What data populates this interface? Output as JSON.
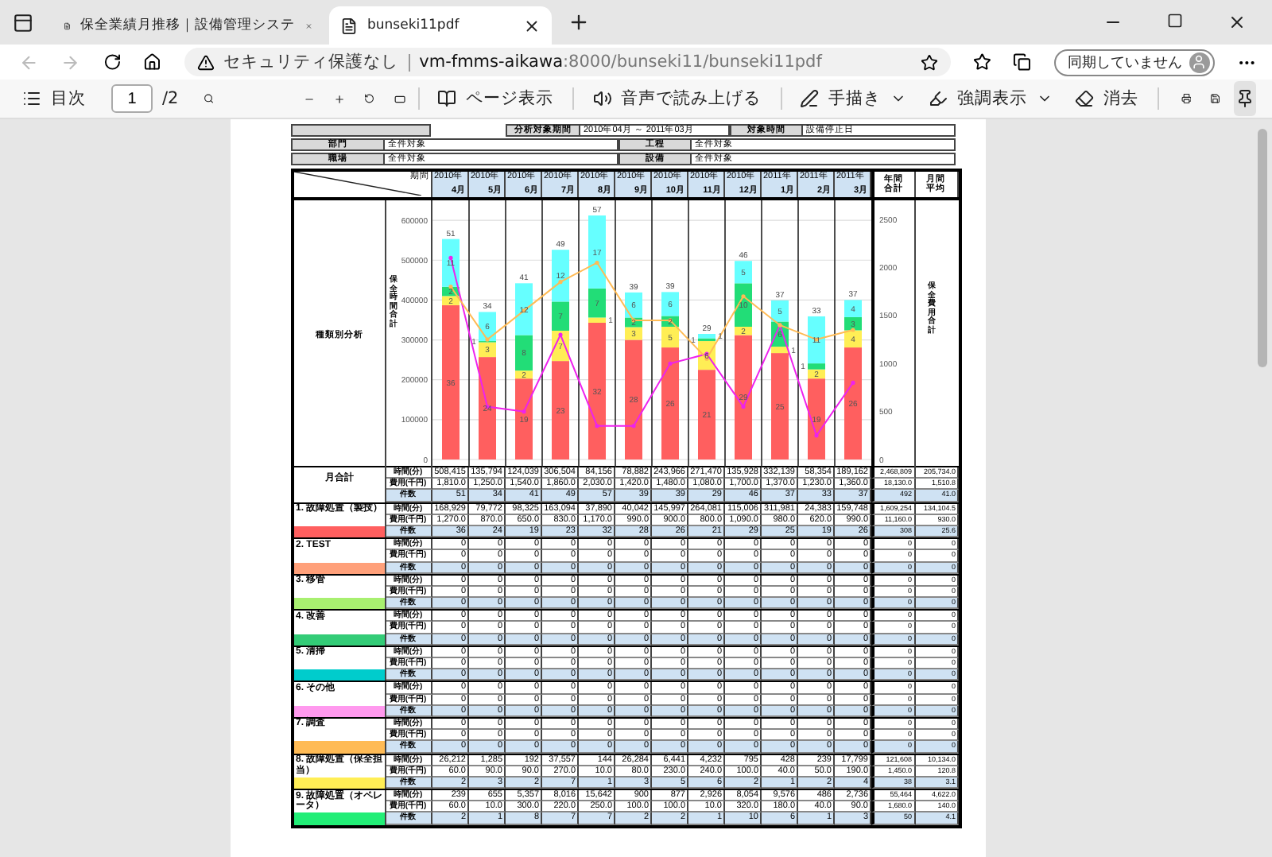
{
  "browser": {
    "tabs": [
      {
        "title": "保全業績月推移｜設備管理システ",
        "selected": false
      },
      {
        "title": "bunseki11pdf",
        "selected": true
      }
    ],
    "security_label": "セキュリティ保護なし",
    "url_host": "vm-fmms-aikawa",
    "url_path": ":8000/bunseki11/bunseki11pdf",
    "profile_label": "同期していません"
  },
  "pdf_toolbar": {
    "contents": "目次",
    "page": "1",
    "page_count": "/2",
    "page_view": "ページ表示",
    "read_aloud": "音声で読み上げる",
    "draw": "手描き",
    "highlight": "強調表示",
    "erase": "消去"
  },
  "report": {
    "period_label": "分析対象期間",
    "period_value": "2010年04月 ～ 2011年03月",
    "time_label": "対象時間",
    "time_value": "設備停止日",
    "filters": [
      [
        {
          "label": "部門",
          "value": "全件対象"
        },
        {
          "label": "工程",
          "value": "全件対象"
        }
      ],
      [
        {
          "label": "職場",
          "value": "全件対象"
        },
        {
          "label": "設備",
          "value": "全件対象"
        }
      ]
    ],
    "corner_label": "期間",
    "months": [
      {
        "year": "2010年",
        "month": "4月"
      },
      {
        "year": "2010年",
        "month": "5月"
      },
      {
        "year": "2010年",
        "month": "6月"
      },
      {
        "year": "2010年",
        "month": "7月"
      },
      {
        "year": "2010年",
        "month": "8月"
      },
      {
        "year": "2010年",
        "month": "9月"
      },
      {
        "year": "2010年",
        "month": "10月"
      },
      {
        "year": "2010年",
        "month": "11月"
      },
      {
        "year": "2010年",
        "month": "12月"
      },
      {
        "year": "2011年",
        "month": "1月"
      },
      {
        "year": "2011年",
        "month": "2月"
      },
      {
        "year": "2011年",
        "month": "3月"
      }
    ],
    "count_labels": {
      "totals": [
        "51",
        "34",
        "41",
        "49",
        "57",
        "39",
        "39",
        "29",
        "46",
        "37",
        "33",
        "37"
      ],
      "segments": [
        [
          "11",
          "6",
          "12",
          "12",
          "17",
          "6",
          "6",
          "1",
          "5",
          "5",
          "11",
          "4"
        ],
        [
          "2",
          "1",
          "8",
          "7",
          "7",
          "2",
          "2",
          "1",
          "10",
          "6",
          "1",
          "3"
        ],
        [
          "2",
          "3",
          "2",
          "7",
          "1",
          "3",
          "5",
          "6",
          "2",
          "1",
          "2",
          "4"
        ],
        [
          "36",
          "24",
          "19",
          "23",
          "32",
          "28",
          "26",
          "21",
          "29",
          "25",
          "19",
          "26"
        ]
      ]
    },
    "total_headers": [
      "年間合計",
      "月間平均"
    ],
    "chart_label": "種類別分析",
    "chart_data": {
      "type": "bar",
      "stacked": true,
      "ylabel": "保全時間合計",
      "y2label": "保全費用合計",
      "ylim": [
        0,
        650000
      ],
      "y2lim": [
        0,
        2700
      ],
      "grid": true,
      "yticks": [
        0,
        100000,
        200000,
        300000,
        400000,
        500000,
        600000
      ],
      "y2ticks": [
        0,
        500,
        1000,
        1500,
        2000,
        2500
      ],
      "series": [
        {
          "color": "#ff5f5f",
          "values": [
            387000,
            257000,
            203000,
            247000,
            343000,
            300000,
            281000,
            225000,
            312000,
            267000,
            203000,
            281000
          ]
        },
        {
          "color": "#ffee55",
          "values": [
            23000,
            37000,
            20000,
            76000,
            13000,
            32000,
            52000,
            72000,
            21000,
            16000,
            23000,
            43000
          ]
        },
        {
          "color": "#22dd77",
          "values": [
            23000,
            3000,
            89000,
            73000,
            73000,
            24000,
            27000,
            7000,
            109000,
            63000,
            15000,
            33000
          ]
        },
        {
          "color": "#66ffff",
          "values": [
            120000,
            73000,
            130000,
            130000,
            183000,
            63000,
            60000,
            11000,
            56000,
            53000,
            118000,
            43000
          ]
        },
        {
          "type": "line",
          "axis": "y2",
          "color": "#ee22ee",
          "values": [
            2100,
            550,
            500,
            1300,
            350,
            350,
            1000,
            1100,
            550,
            1400,
            250,
            800
          ]
        },
        {
          "type": "line",
          "axis": "y2",
          "color": "#ffbb55",
          "values": [
            1800,
            1250,
            1550,
            1850,
            2050,
            1450,
            1450,
            1050,
            1700,
            1400,
            1250,
            1350
          ]
        }
      ]
    },
    "groups": [
      {
        "kind": "total",
        "label": "月合計",
        "rows": [
          {
            "measure": "時間(分)",
            "values": [
              "508,415",
              "135,794",
              "124,039",
              "306,504",
              "84,156",
              "78,882",
              "243,966",
              "271,470",
              "135,928",
              "332,139",
              "58,354",
              "189,162",
              "2,468,809",
              "205,734.0"
            ]
          },
          {
            "measure": "費用(千円)",
            "values": [
              "1,810.0",
              "1,250.0",
              "1,540.0",
              "1,860.0",
              "2,030.0",
              "1,420.0",
              "1,480.0",
              "1,080.0",
              "1,700.0",
              "1,370.0",
              "1,230.0",
              "1,360.0",
              "18,130.0",
              "1,510.8"
            ]
          },
          {
            "measure": "件数",
            "values": [
              "51",
              "34",
              "41",
              "49",
              "57",
              "39",
              "39",
              "29",
              "46",
              "37",
              "33",
              "37",
              "492",
              "41.0"
            ]
          }
        ]
      },
      {
        "kind": "category",
        "label": "1. 故障処置（製技）",
        "color": "#ff5f5f",
        "rows": [
          {
            "measure": "時間(分)",
            "values": [
              "168,929",
              "79,772",
              "98,325",
              "163,094",
              "37,890",
              "40,042",
              "145,997",
              "264,081",
              "115,006",
              "311,981",
              "24,383",
              "159,748",
              "1,609,254",
              "134,104.5"
            ]
          },
          {
            "measure": "費用(千円)",
            "values": [
              "1,270.0",
              "870.0",
              "650.0",
              "830.0",
              "1,170.0",
              "990.0",
              "900.0",
              "800.0",
              "1,090.0",
              "980.0",
              "620.0",
              "990.0",
              "11,160.0",
              "930.0"
            ]
          },
          {
            "measure": "件数",
            "values": [
              "36",
              "24",
              "19",
              "23",
              "32",
              "28",
              "26",
              "21",
              "29",
              "25",
              "19",
              "26",
              "308",
              "25.6"
            ]
          }
        ]
      },
      {
        "kind": "category",
        "label": "2. TEST",
        "color": "#ffa07a",
        "rows": [
          {
            "measure": "時間(分)",
            "values": [
              "0",
              "0",
              "0",
              "0",
              "0",
              "0",
              "0",
              "0",
              "0",
              "0",
              "0",
              "0",
              "0",
              "0"
            ]
          },
          {
            "measure": "費用(千円)",
            "values": [
              "0",
              "0",
              "0",
              "0",
              "0",
              "0",
              "0",
              "0",
              "0",
              "0",
              "0",
              "0",
              "0",
              "0"
            ]
          },
          {
            "measure": "件数",
            "values": [
              "0",
              "0",
              "0",
              "0",
              "0",
              "0",
              "0",
              "0",
              "0",
              "0",
              "0",
              "0",
              "0",
              "0"
            ]
          }
        ]
      },
      {
        "kind": "category",
        "label": "3. 移管",
        "color": "#a8f070",
        "rows": [
          {
            "measure": "時間(分)",
            "values": [
              "0",
              "0",
              "0",
              "0",
              "0",
              "0",
              "0",
              "0",
              "0",
              "0",
              "0",
              "0",
              "0",
              "0"
            ]
          },
          {
            "measure": "費用(千円)",
            "values": [
              "0",
              "0",
              "0",
              "0",
              "0",
              "0",
              "0",
              "0",
              "0",
              "0",
              "0",
              "0",
              "0",
              "0"
            ]
          },
          {
            "measure": "件数",
            "values": [
              "0",
              "0",
              "0",
              "0",
              "0",
              "0",
              "0",
              "0",
              "0",
              "0",
              "0",
              "0",
              "0",
              "0"
            ]
          }
        ]
      },
      {
        "kind": "category",
        "label": "4. 改善",
        "color": "#33cc77",
        "rows": [
          {
            "measure": "時間(分)",
            "values": [
              "0",
              "0",
              "0",
              "0",
              "0",
              "0",
              "0",
              "0",
              "0",
              "0",
              "0",
              "0",
              "0",
              "0"
            ]
          },
          {
            "measure": "費用(千円)",
            "values": [
              "0",
              "0",
              "0",
              "0",
              "0",
              "0",
              "0",
              "0",
              "0",
              "0",
              "0",
              "0",
              "0",
              "0"
            ]
          },
          {
            "measure": "件数",
            "values": [
              "0",
              "0",
              "0",
              "0",
              "0",
              "0",
              "0",
              "0",
              "0",
              "0",
              "0",
              "0",
              "0",
              "0"
            ]
          }
        ]
      },
      {
        "kind": "category",
        "label": "5. 清掃",
        "color": "#00cccc",
        "rows": [
          {
            "measure": "時間(分)",
            "values": [
              "0",
              "0",
              "0",
              "0",
              "0",
              "0",
              "0",
              "0",
              "0",
              "0",
              "0",
              "0",
              "0",
              "0"
            ]
          },
          {
            "measure": "費用(千円)",
            "values": [
              "0",
              "0",
              "0",
              "0",
              "0",
              "0",
              "0",
              "0",
              "0",
              "0",
              "0",
              "0",
              "0",
              "0"
            ]
          },
          {
            "measure": "件数",
            "values": [
              "0",
              "0",
              "0",
              "0",
              "0",
              "0",
              "0",
              "0",
              "0",
              "0",
              "0",
              "0",
              "0",
              "0"
            ]
          }
        ]
      },
      {
        "kind": "category",
        "label": "6. その他",
        "color": "#ff99ee",
        "rows": [
          {
            "measure": "時間(分)",
            "values": [
              "0",
              "0",
              "0",
              "0",
              "0",
              "0",
              "0",
              "0",
              "0",
              "0",
              "0",
              "0",
              "0",
              "0"
            ]
          },
          {
            "measure": "費用(千円)",
            "values": [
              "0",
              "0",
              "0",
              "0",
              "0",
              "0",
              "0",
              "0",
              "0",
              "0",
              "0",
              "0",
              "0",
              "0"
            ]
          },
          {
            "measure": "件数",
            "values": [
              "0",
              "0",
              "0",
              "0",
              "0",
              "0",
              "0",
              "0",
              "0",
              "0",
              "0",
              "0",
              "0",
              "0"
            ]
          }
        ]
      },
      {
        "kind": "category",
        "label": "7. 調査",
        "color": "#ffbb55",
        "rows": [
          {
            "measure": "時間(分)",
            "values": [
              "0",
              "0",
              "0",
              "0",
              "0",
              "0",
              "0",
              "0",
              "0",
              "0",
              "0",
              "0",
              "0",
              "0"
            ]
          },
          {
            "measure": "費用(千円)",
            "values": [
              "0",
              "0",
              "0",
              "0",
              "0",
              "0",
              "0",
              "0",
              "0",
              "0",
              "0",
              "0",
              "0",
              "0"
            ]
          },
          {
            "measure": "件数",
            "values": [
              "0",
              "0",
              "0",
              "0",
              "0",
              "0",
              "0",
              "0",
              "0",
              "0",
              "0",
              "0",
              "0",
              "0"
            ]
          }
        ]
      },
      {
        "kind": "category",
        "label": "8. 故障処置（保全担当）",
        "color": "#ffee55",
        "rows": [
          {
            "measure": "時間(分)",
            "values": [
              "26,212",
              "1,285",
              "192",
              "37,557",
              "144",
              "26,284",
              "6,441",
              "4,232",
              "795",
              "428",
              "239",
              "17,799",
              "121,608",
              "10,134.0"
            ]
          },
          {
            "measure": "費用(千円)",
            "values": [
              "60.0",
              "90.0",
              "90.0",
              "270.0",
              "10.0",
              "80.0",
              "230.0",
              "240.0",
              "100.0",
              "40.0",
              "50.0",
              "190.0",
              "1,450.0",
              "120.8"
            ]
          },
          {
            "measure": "件数",
            "values": [
              "2",
              "3",
              "2",
              "7",
              "1",
              "3",
              "5",
              "6",
              "2",
              "1",
              "2",
              "4",
              "38",
              "3.1"
            ]
          }
        ]
      },
      {
        "kind": "category",
        "label": "9. 故障処置（オペレータ）",
        "color": "#22ee77",
        "rows": [
          {
            "measure": "時間(分)",
            "values": [
              "239",
              "655",
              "5,357",
              "8,016",
              "15,642",
              "900",
              "877",
              "2,926",
              "8,054",
              "9,576",
              "486",
              "2,736",
              "55,464",
              "4,622.0"
            ]
          },
          {
            "measure": "費用(千円)",
            "values": [
              "60.0",
              "10.0",
              "300.0",
              "220.0",
              "250.0",
              "100.0",
              "100.0",
              "10.0",
              "320.0",
              "180.0",
              "40.0",
              "90.0",
              "1,680.0",
              "140.0"
            ]
          },
          {
            "measure": "件数",
            "values": [
              "2",
              "1",
              "8",
              "7",
              "7",
              "2",
              "2",
              "1",
              "10",
              "6",
              "1",
              "3",
              "50",
              "4.1"
            ]
          }
        ]
      }
    ]
  }
}
